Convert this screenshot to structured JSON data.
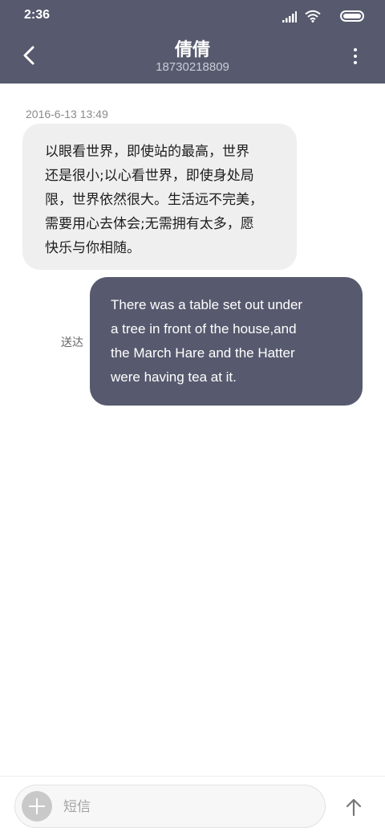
{
  "status_bar": {
    "time": "2:36",
    "icons": [
      "signal-icon",
      "wifi-icon",
      "battery-icon"
    ]
  },
  "header": {
    "contact_name": "倩倩",
    "contact_number": "18730218809",
    "icons": [
      "back-icon",
      "more-icon"
    ]
  },
  "conversation": {
    "timestamp": "2016-6-13 13:49",
    "incoming": {
      "lines": [
        "以眼看世界，即使站的最高，世界",
        "还是很小;以心看世界，即使身处局",
        "限，世界依然很大。生活远不完美，",
        "需要用心去体会;无需拥有太多，愿",
        "快乐与你相随。"
      ]
    },
    "outgoing": {
      "lines": [
        "There was a table set out under",
        "a tree in front of the house,and",
        "the March Hare and the Hatter",
        "were having tea at it."
      ],
      "status": "送达"
    }
  },
  "composer": {
    "placeholder": "短信",
    "icons": [
      "add-icon",
      "send-arrow-icon"
    ]
  },
  "colors": {
    "header_bg": "#575a6e",
    "outgoing_bubble": "#575a6e",
    "incoming_bubble": "#efefef"
  }
}
